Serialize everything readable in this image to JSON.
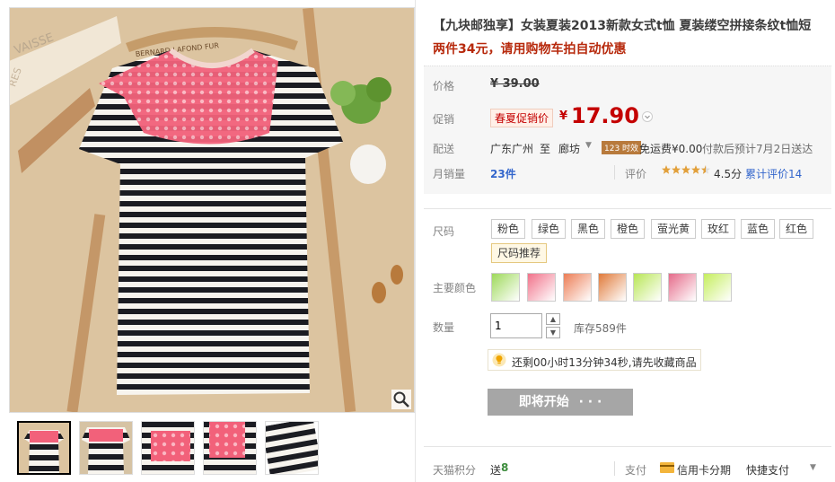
{
  "product": {
    "title": "【九块邮独享】女装夏装2013新款女式t恤 夏装缕空拼接条纹t恤短",
    "subtitle": "两件34元，请用购物车拍自动优惠"
  },
  "price": {
    "label": "价格",
    "original": "¥ 39.00"
  },
  "promo": {
    "label": "促销",
    "badge": "春夏促销价",
    "currency": "¥",
    "value": "17.90"
  },
  "shipping": {
    "label": "配送",
    "from": "广东广州",
    "to_word": "至",
    "to": "廊坊",
    "badge": "123 时效",
    "fee": "免运费¥0.00",
    "eta": "付款后预计7月2日送达"
  },
  "sales": {
    "label": "月销量",
    "count": "23件",
    "rating_label": "评价",
    "stars": 4.5,
    "score": "4.5分",
    "review_text": "累计评价14"
  },
  "size": {
    "label": "尺码",
    "options": [
      "粉色",
      "绿色",
      "黑色",
      "橙色",
      "萤光黄",
      "玫红",
      "蓝色",
      "红色"
    ],
    "guide": "尺码推荐"
  },
  "color": {
    "label": "主要颜色",
    "swatches": [
      "#9ed95a",
      "#f1728a",
      "#ec7d55",
      "#e07a3a",
      "#b8e655",
      "#e56b8a",
      "#c5ee5d"
    ]
  },
  "quantity": {
    "label": "数量",
    "value": "1",
    "stock": "库存589件",
    "up": "▲",
    "down": "▼"
  },
  "countdown": {
    "text": "还剩00小时13分钟34秒,请先收藏商品"
  },
  "buy": {
    "label": "即将开始",
    "dots": "· · ·"
  },
  "footer": {
    "points_label": "天猫积分",
    "points_prefix": "送",
    "points_value": "8",
    "pay_label": "支付",
    "installment": "信用卡分期",
    "quick_pay": "快捷支付"
  },
  "photo_text": {
    "label_top": "VAISSE",
    "label_left": "RES",
    "hanger_tag": "BERNARD LAFOND FUR"
  },
  "colors": {
    "accent": "#c40000",
    "subtitle": "#b7290c",
    "link": "#3366cc",
    "button": "#a6a6a6"
  },
  "icons": [
    "zoom-icon",
    "star-icon",
    "bulb-icon",
    "card-icon",
    "chevron-down-icon"
  ]
}
